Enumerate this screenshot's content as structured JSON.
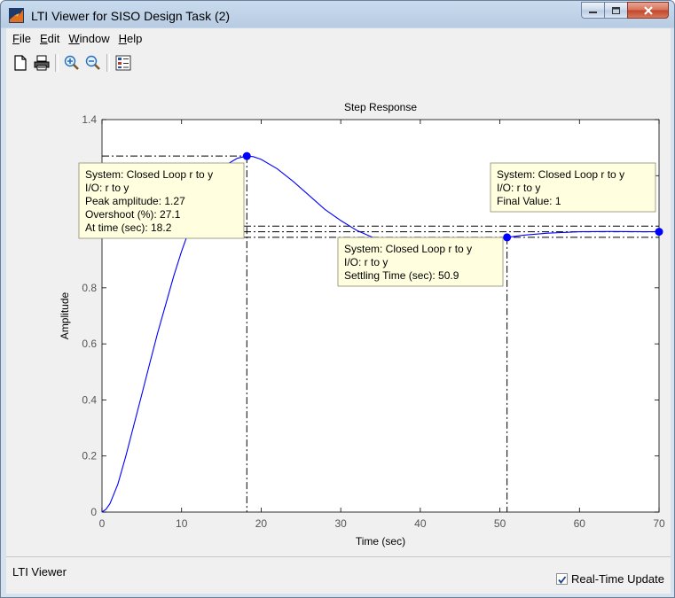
{
  "window": {
    "title": "LTI Viewer for SISO Design Task (2)"
  },
  "menu": {
    "items": [
      {
        "prefix": "",
        "ul": "F",
        "rest": "ile"
      },
      {
        "prefix": "",
        "ul": "E",
        "rest": "dit"
      },
      {
        "prefix": "",
        "ul": "W",
        "rest": "indow"
      },
      {
        "prefix": "",
        "ul": "H",
        "rest": "elp"
      }
    ]
  },
  "toolbar": {
    "icons": [
      "new-document-icon",
      "print-icon",
      "zoom-in-icon",
      "zoom-out-icon",
      "plot-configurations-icon"
    ]
  },
  "status": {
    "text": "LTI Viewer",
    "realtime_label": "Real-Time Update",
    "realtime_checked": true
  },
  "chart_data": {
    "type": "line",
    "title": "Step Response",
    "xlabel": "Time (sec)",
    "ylabel": "Amplitude",
    "xlim": [
      0,
      70
    ],
    "ylim": [
      0,
      1.4
    ],
    "xticks": [
      "0",
      "10",
      "20",
      "30",
      "40",
      "50",
      "60",
      "70"
    ],
    "yticks": [
      "0",
      "0.2",
      "0.4",
      "0.6",
      "0.8",
      "1",
      "1.2",
      "1.4"
    ],
    "series": [
      {
        "color": "#0000ff",
        "x": [
          0,
          0.5,
          1,
          2,
          3,
          4,
          5,
          6,
          7,
          8,
          9,
          10,
          11,
          12,
          13,
          14,
          15,
          16,
          17,
          18.2,
          19,
          20,
          22,
          24,
          26,
          28,
          30,
          32,
          34,
          36,
          38,
          40,
          42,
          44,
          46,
          48,
          50.9,
          53,
          56,
          60,
          64,
          68,
          70
        ],
        "y": [
          0,
          0.01,
          0.03,
          0.1,
          0.2,
          0.31,
          0.42,
          0.53,
          0.64,
          0.74,
          0.84,
          0.93,
          1.01,
          1.08,
          1.14,
          1.19,
          1.22,
          1.245,
          1.262,
          1.27,
          1.268,
          1.258,
          1.225,
          1.18,
          1.13,
          1.08,
          1.04,
          1.005,
          0.98,
          0.965,
          0.955,
          0.953,
          0.956,
          0.96,
          0.965,
          0.971,
          0.98,
          0.988,
          0.995,
          1.0,
          1.001,
          1.0,
          1.0
        ]
      }
    ],
    "markers": [
      {
        "x": 18.2,
        "y": 1.27
      },
      {
        "x": 50.9,
        "y": 0.98
      },
      {
        "x": 70,
        "y": 1.0
      }
    ],
    "annotations": [
      {
        "lines": [
          "System: Closed Loop r to y",
          "I/O: r to y",
          "Peak amplitude: 1.27",
          "Overshoot (%): 27.1",
          "At time (sec): 18.2"
        ]
      },
      {
        "lines": [
          "System: Closed Loop r to y",
          "I/O: r to y",
          "Settling Time (sec): 50.9"
        ]
      },
      {
        "lines": [
          "System: Closed Loop r to y",
          "I/O: r to y",
          "Final Value: 1"
        ]
      }
    ],
    "grid": false
  }
}
